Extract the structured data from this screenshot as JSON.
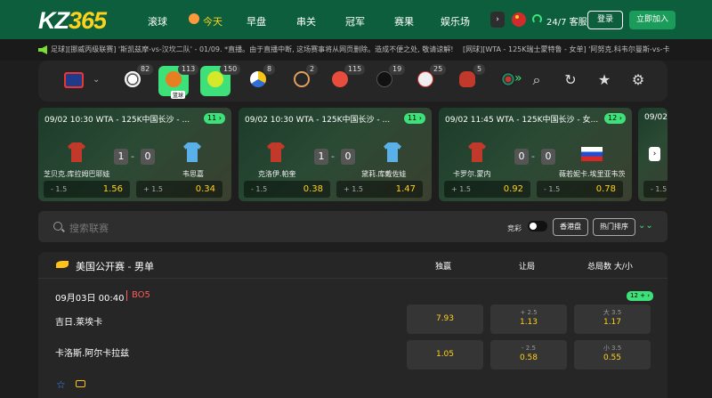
{
  "header": {
    "logo_a": "KZ",
    "logo_b": "365",
    "nav": [
      "滚球",
      "今天",
      "早盘",
      "串关",
      "冠军",
      "赛果",
      "娱乐场"
    ],
    "nav_active": 1,
    "more": "›",
    "support": "24/7 客服",
    "login": "登录",
    "join": "立即加入"
  },
  "ticker": {
    "left": "足球][挪威丙级联赛] '斯凯兹摩-vs-汉坎二队' - 01/09. *直播。由于直播中断, 这场赛事将从网页删除。造成不便之处, 敬请谅解!",
    "right": "[网球][WTA - 125K瑞士蒙特鲁 - 女单] '阿努克.科韦尔曼斯-vs-卡森.B"
  },
  "sports": {
    "items": [
      {
        "icon": "soccer-icon",
        "count": "82"
      },
      {
        "icon": "basketball-icon",
        "count": "113",
        "label": "篮球"
      },
      {
        "icon": "tennis-icon",
        "count": "150",
        "selected": true
      },
      {
        "icon": "volleyball-icon",
        "count": "8"
      },
      {
        "icon": "badminton-icon",
        "count": "2"
      },
      {
        "icon": "table-tennis-icon",
        "count": "115"
      },
      {
        "icon": "snooker-icon",
        "count": "19"
      },
      {
        "icon": "baseball-icon",
        "count": "25"
      },
      {
        "icon": "boxing-icon",
        "count": "5"
      },
      {
        "icon": "darts-icon",
        "count": ""
      }
    ]
  },
  "cards": [
    {
      "title": "09/02 10:30   WTA - 125K中国长沙 - ...",
      "badge": "11 ›",
      "s1": "1",
      "s2": "0",
      "t1": "芝贝克.库拉姆巴耶娃",
      "t2": "韦思嘉",
      "o1l": "- 1.5",
      "o1r": "1.56",
      "o2l": "+ 1.5",
      "o2r": "0.34",
      "c1": "#c0392b",
      "c2": "#5ab0e8"
    },
    {
      "title": "09/02 10:30   WTA - 125K中国长沙 - ...",
      "badge": "11 ›",
      "s1": "1",
      "s2": "0",
      "t1": "克洛伊.帕奎",
      "t2": "黛莉.库戴佐娃",
      "o1l": "- 1.5",
      "o1r": "0.38",
      "o2l": "+ 1.5",
      "o2r": "1.47",
      "c1": "#c0392b",
      "c2": "#5ab0e8"
    },
    {
      "title": "09/02 11:45   WTA - 125K中国长沙 - 女...",
      "badge": "12 ›",
      "s1": "0",
      "s2": "0",
      "t1": "卡罗尔.蒙内",
      "t2": "薇若妮卡.埃里亚韦茨",
      "o1l": "+ 1.5",
      "o1r": "0.92",
      "o2l": "- 1.5",
      "o2r": "0.78",
      "c1": "#c0392b",
      "c2": "flag"
    },
    {
      "title": "09/02",
      "badge": "",
      "s1": "",
      "s2": "",
      "t1": "",
      "t2": "",
      "o1l": "- 1.5",
      "o1r": "",
      "o2l": "",
      "o2r": "",
      "c1": "",
      "c2": ""
    }
  ],
  "filter": {
    "search_placeholder": "搜索联赛",
    "toggle_label": "竞彩",
    "odds_type": "香港盘",
    "sort": "热门排序"
  },
  "league": {
    "name": "美国公开赛 - 男单",
    "col_win": "独赢",
    "col_handicap": "让局",
    "col_total": "总局数 大/小",
    "match": {
      "time": "09月03日 00:40",
      "bo": "BO5",
      "badge": "12 +  ›",
      "p1": "吉日.莱埃卡",
      "p2": "卡洛斯.阿尔卡拉兹",
      "win1": "7.93",
      "win2": "1.05",
      "hc1_line": "+ 2.5",
      "hc1": "1.13",
      "hc2_line": "- 2.5",
      "hc2": "0.58",
      "tot1_line": "大 3.5",
      "tot1": "1.17",
      "tot2_line": "小 3.5",
      "tot2": "0.55"
    }
  }
}
